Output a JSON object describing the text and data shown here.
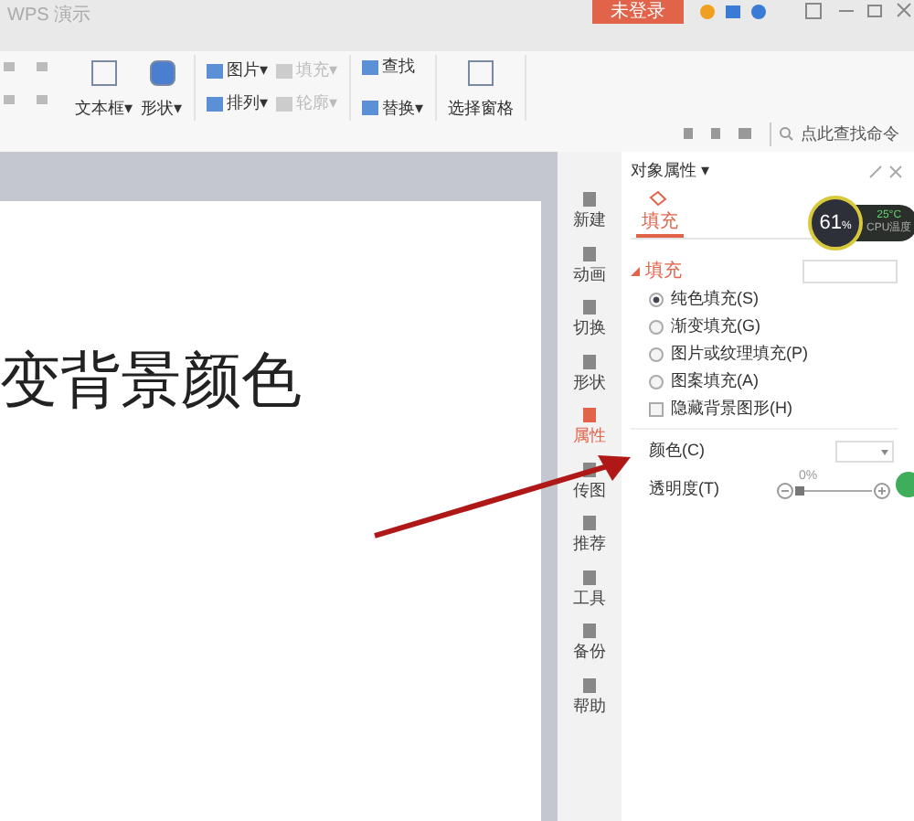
{
  "window": {
    "title": "WPS 演示",
    "login_button": "未登录"
  },
  "ribbon": {
    "groups": [
      {
        "items": [
          {
            "label": "文本框▾",
            "greyed": false
          },
          {
            "label": "形状▾",
            "greyed": false
          }
        ]
      },
      {
        "items": [
          {
            "label": "图片▾",
            "greyed": false
          },
          {
            "label": "填充▾",
            "greyed": true
          },
          {
            "label": "排列▾",
            "greyed": false
          },
          {
            "label": "轮廓▾",
            "greyed": true
          }
        ]
      },
      {
        "items": [
          {
            "label": "查找",
            "greyed": false
          },
          {
            "label": "替换▾",
            "greyed": false
          }
        ]
      },
      {
        "items": [
          {
            "label": "选择窗格",
            "greyed": false
          }
        ]
      }
    ],
    "command_search": {
      "placeholder": "点此查找命令"
    }
  },
  "slide": {
    "title": "变背景颜色"
  },
  "side_tabs": [
    {
      "label": "新建",
      "selected": false
    },
    {
      "label": "动画",
      "selected": false
    },
    {
      "label": "切换",
      "selected": false
    },
    {
      "label": "形状",
      "selected": false
    },
    {
      "label": "属性",
      "selected": true
    },
    {
      "label": "传图",
      "selected": false
    },
    {
      "label": "推荐",
      "selected": false
    },
    {
      "label": "工具",
      "selected": false
    },
    {
      "label": "备份",
      "selected": false
    },
    {
      "label": "帮助",
      "selected": false
    }
  ],
  "panel": {
    "title": "对象属性 ▾",
    "tabs": [
      {
        "label": "填充",
        "selected": true
      }
    ],
    "section": "填充",
    "options": [
      {
        "kind": "radio",
        "label": "纯色填充(S)",
        "selected": true
      },
      {
        "kind": "radio",
        "label": "渐变填充(G)",
        "selected": false
      },
      {
        "kind": "radio",
        "label": "图片或纹理填充(P)",
        "selected": false
      },
      {
        "kind": "radio",
        "label": "图案填充(A)",
        "selected": false
      },
      {
        "kind": "checkbox",
        "label": "隐藏背景图形(H)",
        "checked": false
      }
    ],
    "color_label": "颜色(C)",
    "transparency_label": "透明度(T)",
    "transparency": {
      "level": 0,
      "reading": "0%"
    }
  },
  "cpu_widget": {
    "usage": "61",
    "unit": "%",
    "temperature": "25°C",
    "caption": "CPU温度"
  }
}
